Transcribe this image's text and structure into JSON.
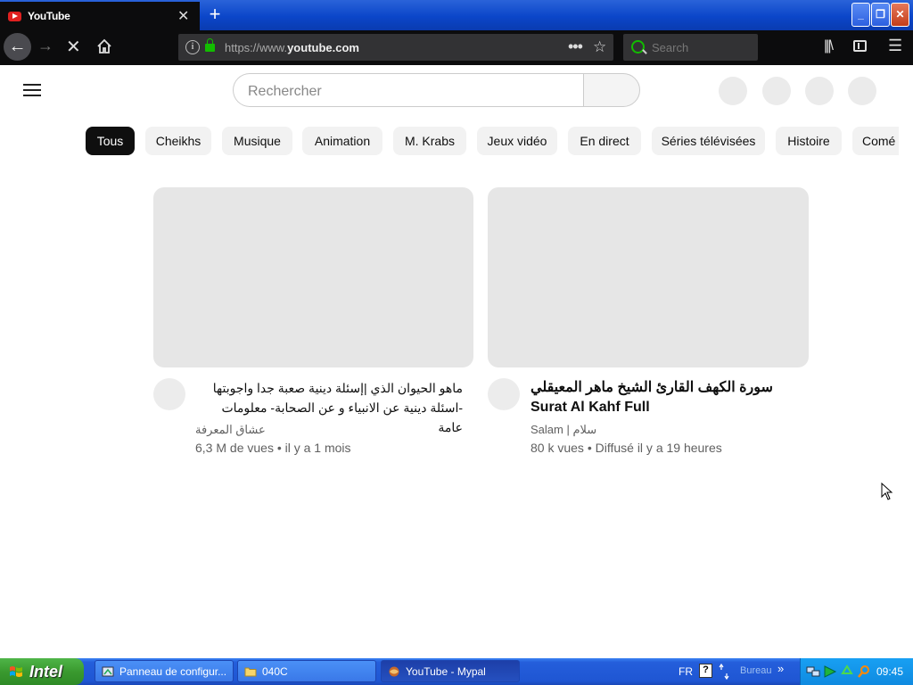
{
  "browser": {
    "tab_title": "YouTube",
    "tab_close": "✕",
    "new_tab": "+",
    "url_prefix": "https://www.",
    "url_domain": "youtube.com",
    "search_placeholder": "Search",
    "page_actions": "•••",
    "bookmark_star": "☆"
  },
  "youtube": {
    "search_placeholder": "Rechercher",
    "chips": [
      {
        "label": "Tous",
        "active": true
      },
      {
        "label": "Cheikhs"
      },
      {
        "label": "Musique"
      },
      {
        "label": "Animation"
      },
      {
        "label": "M. Krabs"
      },
      {
        "label": "Jeux vidéo"
      },
      {
        "label": "En direct"
      },
      {
        "label": "Séries télévisées"
      },
      {
        "label": "Histoire"
      },
      {
        "label": "Comé"
      }
    ],
    "videos": [
      {
        "title": "ماهو الحيوان الذي |إسئلة دينية صعبة جدا واجوبتها -اسئلة دينية عن الانبياء و عن الصحابة- معلومات عامة",
        "channel": "عشاق المعرفة",
        "meta": "6,3 M de vues • il y a 1 mois"
      },
      {
        "title": "سورة الكهف القارئ الشيخ ماهر المعيقلي Surat Al Kahf Full",
        "channel": "Salam | سلام",
        "meta": "80 k vues • Diffusé il y a 19 heures"
      }
    ]
  },
  "taskbar": {
    "start_label": "Intel",
    "items": [
      {
        "label": "Panneau de configur..."
      },
      {
        "label": "040C"
      },
      {
        "label": "YouTube - Mypal"
      }
    ],
    "language": "FR",
    "help": "?",
    "toolbar_label": "Bureau",
    "chevron": "»",
    "clock": "09:45"
  }
}
